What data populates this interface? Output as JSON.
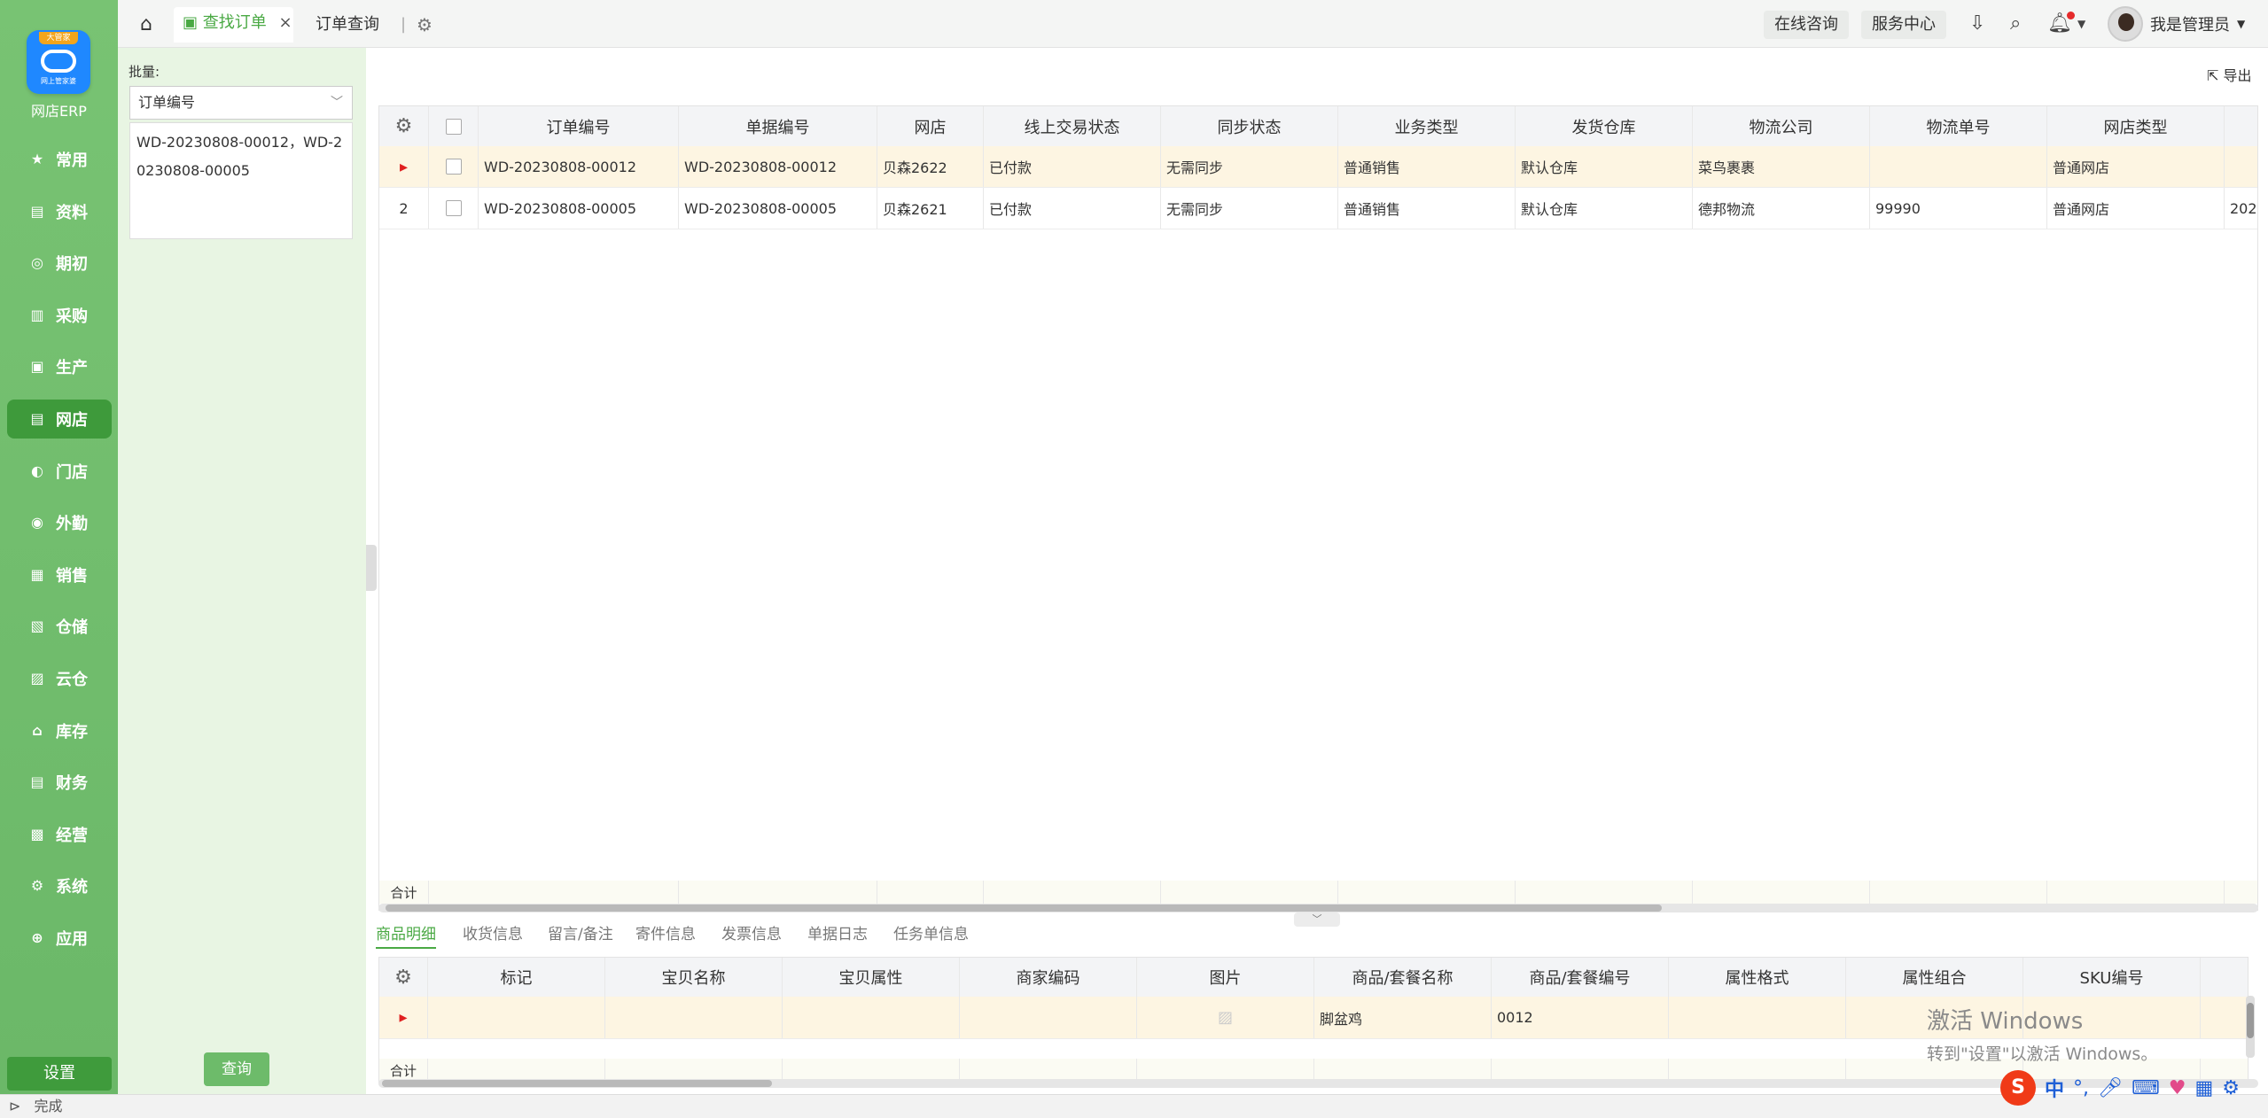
{
  "brand": {
    "badge": "大管家",
    "sub": "网上管家婆",
    "app_name": "网店ERP"
  },
  "nav": [
    {
      "label": "常用",
      "icon": "star-icon",
      "glyph": "★"
    },
    {
      "label": "资料",
      "icon": "document-icon",
      "glyph": "▤"
    },
    {
      "label": "期初",
      "icon": "target-icon",
      "glyph": "◎"
    },
    {
      "label": "采购",
      "icon": "cart-icon",
      "glyph": "▥"
    },
    {
      "label": "生产",
      "icon": "factory-icon",
      "glyph": "▣"
    },
    {
      "label": "网店",
      "icon": "store-icon",
      "glyph": "▤",
      "active": true
    },
    {
      "label": "门店",
      "icon": "shop-icon",
      "glyph": "◐"
    },
    {
      "label": "外勤",
      "icon": "fieldwork-icon",
      "glyph": "◉"
    },
    {
      "label": "销售",
      "icon": "sales-chart-icon",
      "glyph": "▦"
    },
    {
      "label": "仓储",
      "icon": "warehouse-icon",
      "glyph": "▧"
    },
    {
      "label": "云仓",
      "icon": "cloud-warehouse-icon",
      "glyph": "▨"
    },
    {
      "label": "库存",
      "icon": "inventory-icon",
      "glyph": "⌂"
    },
    {
      "label": "财务",
      "icon": "finance-icon",
      "glyph": "▤"
    },
    {
      "label": "经营",
      "icon": "operation-icon",
      "glyph": "▩"
    },
    {
      "label": "系统",
      "icon": "system-icon",
      "glyph": "⚙"
    },
    {
      "label": "应用",
      "icon": "apps-icon",
      "glyph": "⊕"
    }
  ],
  "nav_settings": "设置",
  "tabs": {
    "home_icon": "home-icon",
    "active": "查找订单",
    "second": "订单查询"
  },
  "header": {
    "online_consult": "在线咨询",
    "service_center": "服务中心",
    "user_name": "我是管理员"
  },
  "filter": {
    "batch_label": "批量:",
    "field_select": "订单编号",
    "batch_text": "WD-20230808-00012，WD-20230808-00005",
    "query_button": "查询"
  },
  "export_label": "导出",
  "order_grid": {
    "columns": [
      "订单编号",
      "单据编号",
      "网店",
      "线上交易状态",
      "同步状态",
      "业务类型",
      "发货仓库",
      "物流公司",
      "物流单号",
      "网店类型"
    ],
    "rows": [
      {
        "marker": "▸",
        "cells": [
          "WD-20230808-00012",
          "WD-20230808-00012",
          "贝森2622",
          "已付款",
          "无需同步",
          "普通销售",
          "默认仓库",
          "菜鸟裹裹",
          "",
          "普通网店"
        ],
        "extra": ""
      },
      {
        "marker": "2",
        "cells": [
          "WD-20230808-00005",
          "WD-20230808-00005",
          "贝森2621",
          "已付款",
          "无需同步",
          "普通销售",
          "默认仓库",
          "德邦物流",
          "99990",
          "普通网店"
        ],
        "extra": "202"
      }
    ],
    "footer_label": "合计"
  },
  "sub_tabs": [
    "商品明细",
    "收货信息",
    "留言/备注",
    "寄件信息",
    "发票信息",
    "单据日志",
    "任务单信息"
  ],
  "detail_grid": {
    "columns": [
      "标记",
      "宝贝名称",
      "宝贝属性",
      "商家编码",
      "图片",
      "商品/套餐名称",
      "商品/套餐编号",
      "属性格式",
      "属性组合",
      "SKU编号"
    ],
    "rows": [
      {
        "marker": "▸",
        "cells": [
          "",
          "",
          "",
          "",
          "",
          "脚盆鸡",
          "0012",
          "",
          "",
          ""
        ]
      }
    ],
    "footer_label": "合计"
  },
  "watermark": {
    "line1": "激活 Windows",
    "line2": "转到\"设置\"以激活 Windows。"
  },
  "status_bar": {
    "text": "完成"
  },
  "ime": {
    "logo": "S",
    "lang": "中"
  }
}
